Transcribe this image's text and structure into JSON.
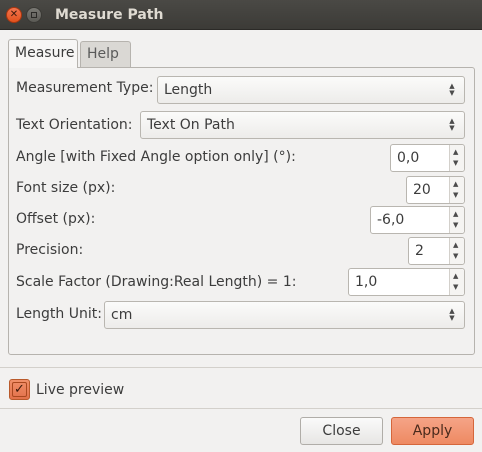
{
  "window": {
    "title": "Measure Path"
  },
  "tabs": [
    {
      "label": "Measure",
      "active": true
    },
    {
      "label": "Help",
      "active": false
    }
  ],
  "fields": {
    "measurement_type": {
      "label": "Measurement Type:",
      "value": "Length"
    },
    "text_orientation": {
      "label": "Text Orientation:",
      "value": "Text On Path"
    },
    "angle": {
      "label": "Angle [with Fixed Angle option only] (°):",
      "value": "0,0"
    },
    "font_size": {
      "label": "Font size (px):",
      "value": "20"
    },
    "offset": {
      "label": "Offset (px):",
      "value": "-6,0"
    },
    "precision": {
      "label": "Precision:",
      "value": "2"
    },
    "scale_factor": {
      "label": "Scale Factor (Drawing:Real Length) = 1:",
      "value": "1,0"
    },
    "length_unit": {
      "label": "Length Unit:",
      "value": "cm"
    }
  },
  "live_preview": {
    "label": "Live preview",
    "checked": true
  },
  "buttons": {
    "close": "Close",
    "apply": "Apply"
  },
  "colors": {
    "accent": "#ee8a62",
    "titlebar": "#3c3b37",
    "close_button": "#e2521d"
  },
  "icons": {
    "close": "close-icon",
    "minimize": "minimize-icon",
    "check": "checkmark-icon",
    "combo_arrows": "updown-arrows-icon"
  }
}
